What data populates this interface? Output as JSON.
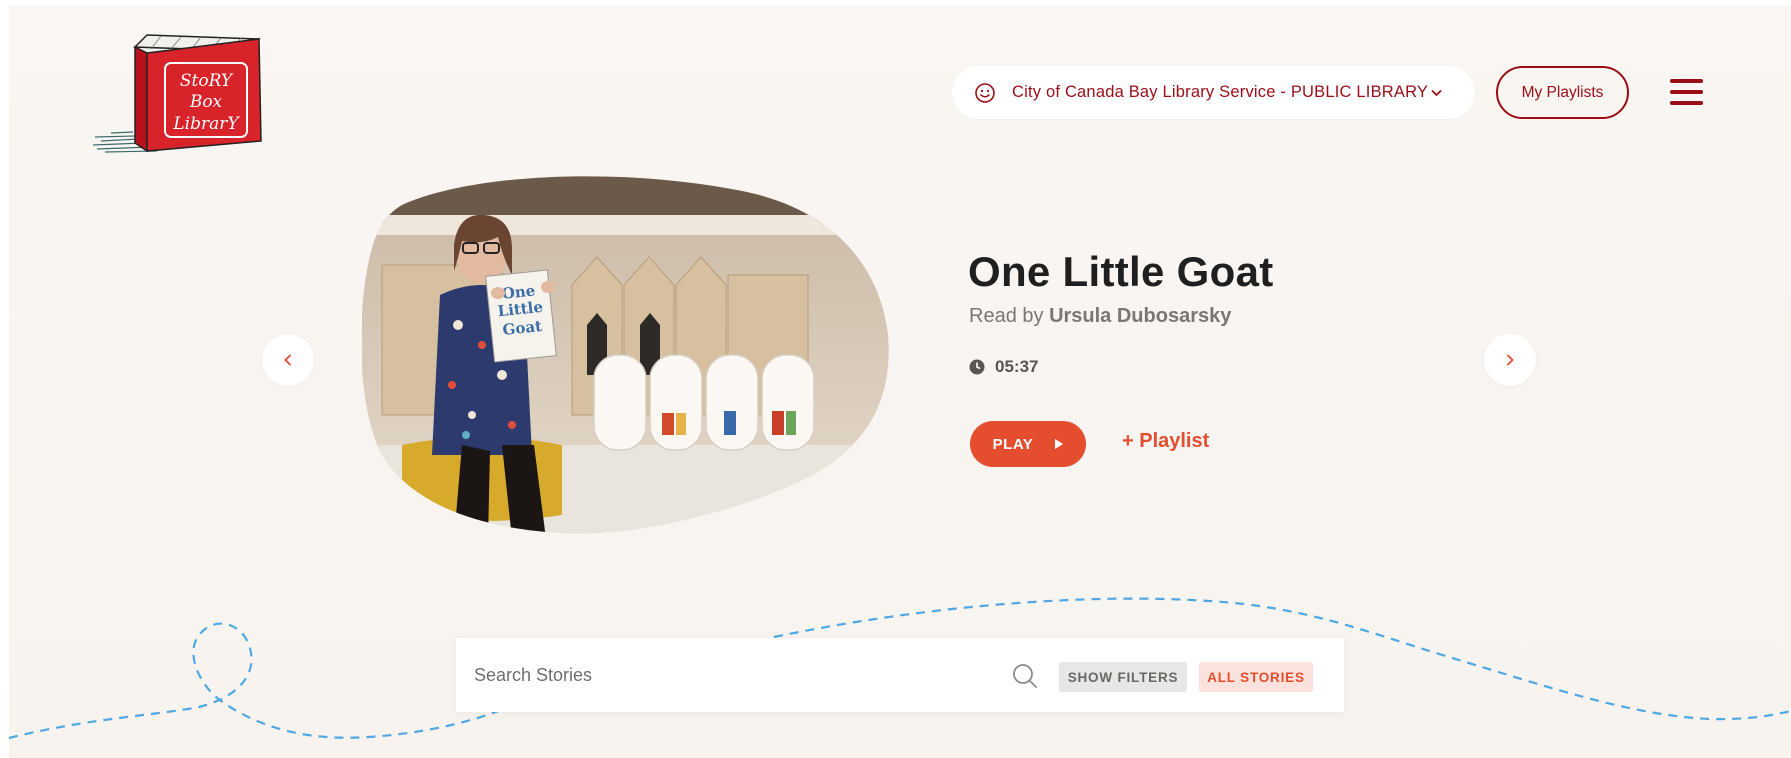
{
  "logo": {
    "alt": "Story Box Library",
    "lines": [
      "StoRY",
      "Box",
      "LibrarY"
    ]
  },
  "header": {
    "library": "City of Canada Bay Library Service - PUBLIC LIBRARY",
    "my_playlists": "My Playlists"
  },
  "hero": {
    "title": "One Little Goat",
    "read_by_prefix": "Read by",
    "reader": "Ursula Dubosarsky",
    "duration": "05:37",
    "play_label": "PLAY",
    "add_playlist": "+ Playlist",
    "book_cover_text": [
      "One",
      "Little",
      "Goat"
    ]
  },
  "search": {
    "placeholder": "Search Stories",
    "show_filters": "SHOW FILTERS",
    "all_stories": "ALL STORIES"
  },
  "icons": {
    "library": "smiley-icon",
    "dropdown": "chevron-down-icon",
    "menu": "hamburger-menu-icon",
    "prev": "chevron-left-icon",
    "next": "chevron-right-icon",
    "clock": "clock-icon",
    "play": "play-triangle-icon",
    "search": "search-icon"
  },
  "colors": {
    "brand_red": "#9b0e16",
    "accent_orange": "#e44e2f",
    "dash_blue": "#4ea8e3",
    "background": "#f9f6f3"
  }
}
